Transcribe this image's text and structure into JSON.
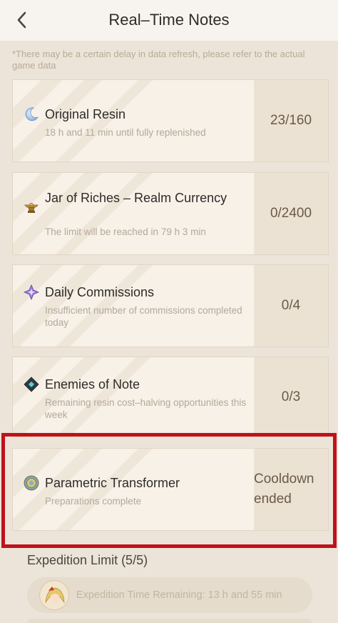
{
  "header": {
    "title": "Real–Time Notes",
    "back_icon": "chevron-left-icon"
  },
  "notice": "*There may be a certain delay in data refresh, please refer to the actual game data",
  "cards": [
    {
      "title": "Original Resin",
      "subtitle": "18 h and 11 min until fully replenished",
      "value": "23/160",
      "icon": "resin-moon-icon"
    },
    {
      "title": "Jar of Riches – Realm Currency",
      "subtitle": "The limit will be reached in 79 h 3 min",
      "value": "0/2400",
      "icon": "jar-of-riches-icon"
    },
    {
      "title": "Daily Commissions",
      "subtitle": "Insufficient number of commissions completed today",
      "value": "0/4",
      "icon": "commission-star-icon"
    },
    {
      "title": "Enemies of Note",
      "subtitle": "Remaining resin cost–halving opportunities this week",
      "value": "0/3",
      "icon": "enemies-diamond-icon"
    },
    {
      "title": "Parametric Transformer",
      "subtitle": "Preparations complete",
      "value_line1": "Cooldown",
      "value_line2": "ended",
      "icon": "parametric-transformer-icon",
      "highlighted": true
    }
  ],
  "expedition": {
    "title": "Expedition Limit (5/5)",
    "items": [
      {
        "text": "Expedition Time Remaining: 13 h and 55 min",
        "avatar_icon": "character-avatar-icon"
      }
    ]
  },
  "colors": {
    "highlight": "#c0121a",
    "background": "#ece4d8",
    "card": "#f7f1e8",
    "value_panel": "#ece2d3"
  }
}
